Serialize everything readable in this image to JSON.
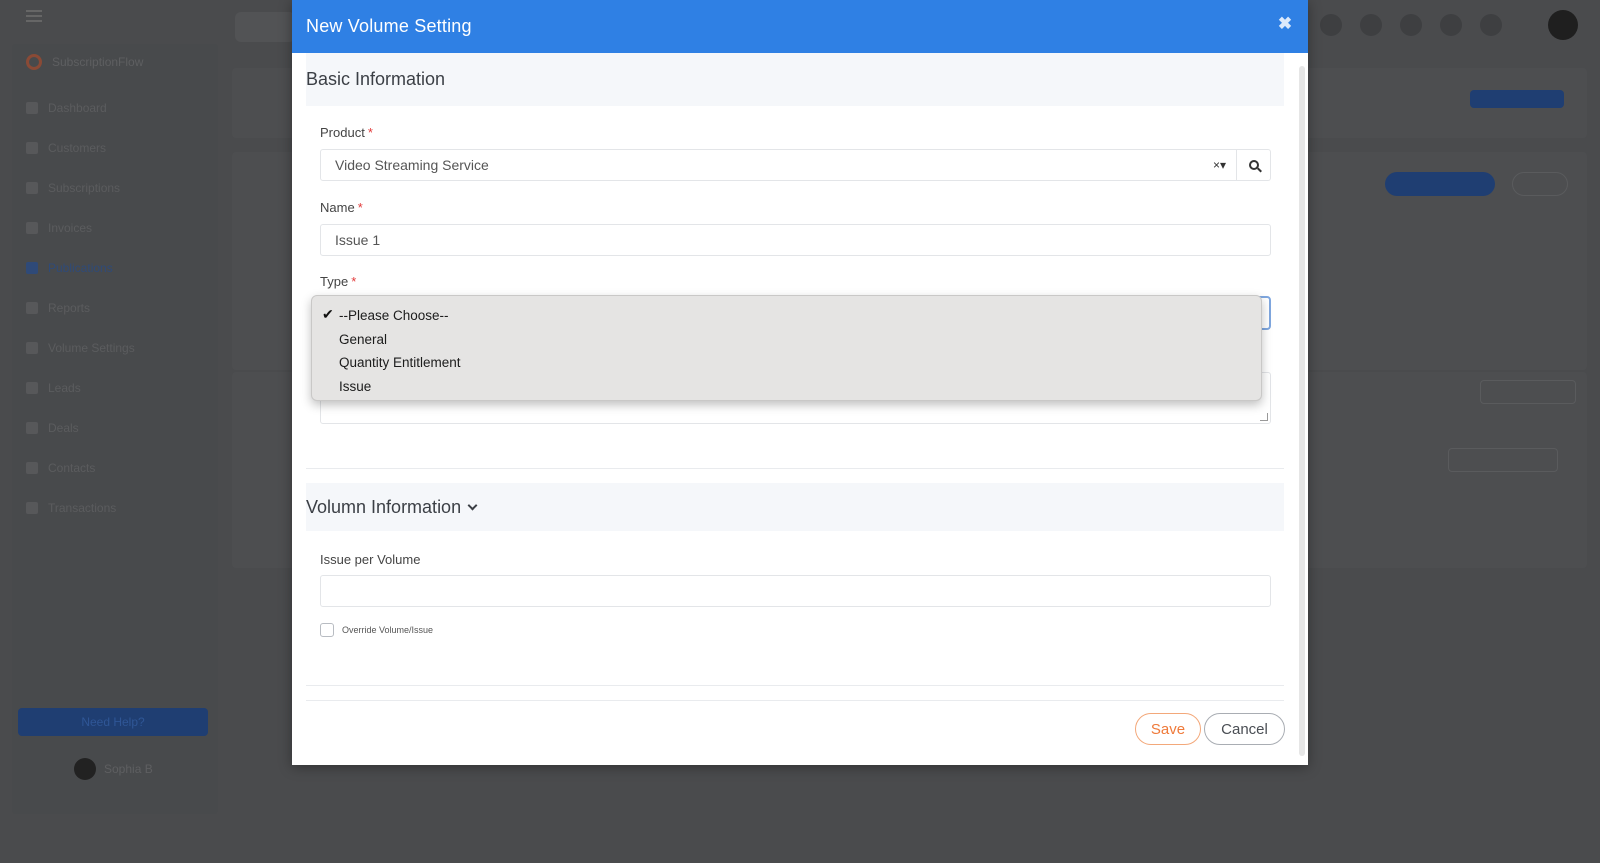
{
  "background_app": {
    "brand": "SubscriptionFlow",
    "sidebar_items": [
      "Dashboard",
      "Customers",
      "Subscriptions",
      "Invoices",
      "Publications",
      "Reports",
      "Volume Settings",
      "Leads",
      "Deals",
      "Contacts",
      "Transactions"
    ],
    "help_button": "Need Help?",
    "user_name": "Sophia B"
  },
  "modal": {
    "title": "New Volume Setting",
    "basic_section": "Basic Information",
    "product": {
      "label": "Product",
      "value": "Video Streaming Service",
      "clear": "×"
    },
    "name": {
      "label": "Name",
      "value": "Issue 1"
    },
    "type": {
      "label": "Type",
      "options": [
        "--Please Choose--",
        "General",
        "Quantity Entitlement",
        "Issue"
      ],
      "selected": "--Please Choose--"
    },
    "volume_section": "Volumn Information",
    "issue_per_volume": {
      "label": "Issue per Volume",
      "value": ""
    },
    "override_checkbox": {
      "label": "Override Volume/Issue",
      "checked": false
    },
    "save_label": "Save",
    "cancel_label": "Cancel",
    "required_mark": "*"
  },
  "colors": {
    "header": "#2f80e4",
    "save": "#ef7a3a",
    "required": "#e23a3a",
    "overlay": "#4a4b4d"
  }
}
